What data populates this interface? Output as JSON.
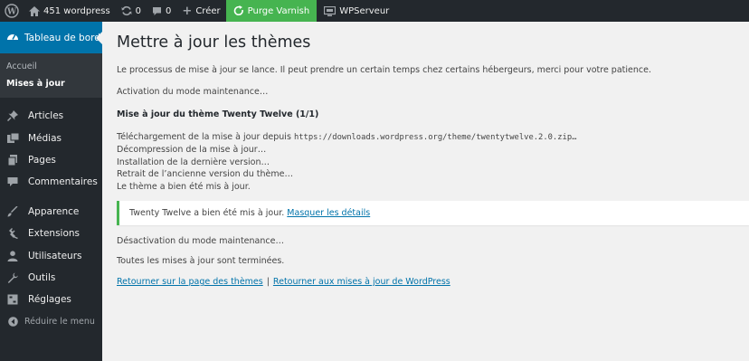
{
  "adminbar": {
    "site_name": "451 wordpress",
    "updates_count": "0",
    "comments_count": "0",
    "new_label": "Créer",
    "purge_label": "Purge Varnish",
    "wpserveur_label": "WPServeur"
  },
  "sidebar": {
    "dashboard_label": "Tableau de bord",
    "submenu": [
      "Accueil",
      "Mises à jour"
    ],
    "items": [
      {
        "label": "Articles",
        "icon": "pin-icon"
      },
      {
        "label": "Médias",
        "icon": "media-icon"
      },
      {
        "label": "Pages",
        "icon": "pages-icon"
      },
      {
        "label": "Commentaires",
        "icon": "comment-icon"
      },
      {
        "label": "Apparence",
        "icon": "brush-icon"
      },
      {
        "label": "Extensions",
        "icon": "plugin-icon"
      },
      {
        "label": "Utilisateurs",
        "icon": "user-icon"
      },
      {
        "label": "Outils",
        "icon": "wrench-icon"
      },
      {
        "label": "Réglages",
        "icon": "settings-icon"
      }
    ],
    "collapse_label": "Réduire le menu"
  },
  "main": {
    "title": "Mettre à jour les thèmes",
    "intro": "Le processus de mise à jour se lance. Il peut prendre un certain temps chez certains hébergeurs, merci pour votre patience.",
    "maintenance_on": "Activation du mode maintenance…",
    "theme_heading": "Mise à jour du thème Twenty Twelve (1/1)",
    "download_prefix": "Téléchargement de la mise à jour depuis",
    "download_url": "https://downloads.wordpress.org/theme/twentytwelve.2.0.zip…",
    "steps": [
      "Décompression de la mise à jour…",
      "Installation de la dernière version…",
      "Retrait de l’ancienne version du thème…",
      "Le thème a bien été mis à jour."
    ],
    "notice_text": "Twenty Twelve a bien été mis à jour. ",
    "notice_link": "Masquer les détails",
    "maintenance_off": "Désactivation du mode maintenance…",
    "all_done": "Toutes les mises à jour sont terminées.",
    "link_themes": "Retourner sur la page des thèmes",
    "link_separator": "|",
    "link_updates": "Retourner aux mises à jour de WordPress"
  }
}
